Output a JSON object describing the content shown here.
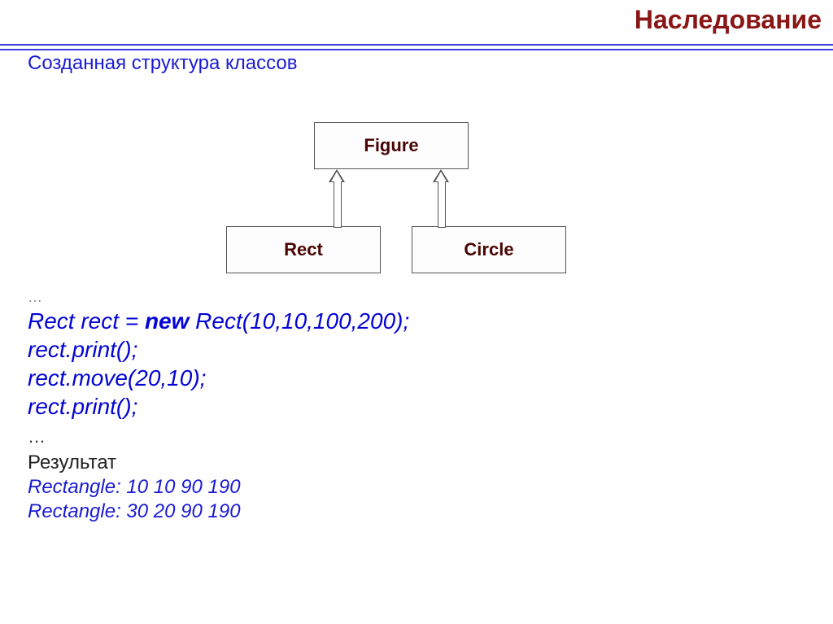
{
  "header": {
    "title": "Наследование"
  },
  "subtitle": "Созданная  структура классов",
  "diagram": {
    "parent": "Figure",
    "children": [
      "Rect",
      "Circle"
    ]
  },
  "code": {
    "ellipsis_top": "…",
    "lines": [
      {
        "pre": "Rect rect = ",
        "kw": "new",
        "post": " Rect(10,10,100,200);"
      },
      {
        "pre": "rect.print();",
        "kw": "",
        "post": ""
      },
      {
        "pre": "rect.move(20,10);",
        "kw": "",
        "post": ""
      },
      {
        "pre": "rect.print();",
        "kw": "",
        "post": ""
      }
    ],
    "ellipsis_bottom": "…"
  },
  "result": {
    "label": "Результат",
    "lines": [
      "Rectangle: 10  10  90  190",
      "Rectangle: 30  20  90  190"
    ]
  }
}
